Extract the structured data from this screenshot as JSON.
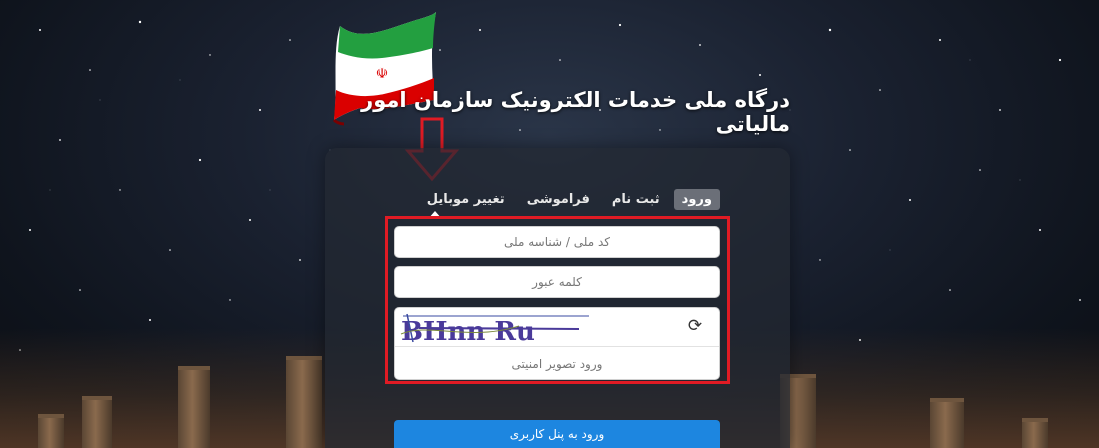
{
  "portal": {
    "title": "درگاه ملی خدمات الکترونیک سازمان امور مالیاتی"
  },
  "tabs": [
    {
      "label": "ورود",
      "active": true
    },
    {
      "label": "ثبت نام",
      "active": false
    },
    {
      "label": "فراموشی",
      "active": false
    },
    {
      "label": "تغییر موبایل",
      "active": false
    }
  ],
  "form": {
    "national_id_placeholder": "کد ملی / شناسه ملی",
    "password_placeholder": "کلمه عبور",
    "captcha_text": "BHnn Ru",
    "captcha_placeholder": "ورود تصویر امنیتی",
    "submit_label": "ورود به پنل کاربری"
  },
  "icons": {
    "refresh": "refresh-icon",
    "flag": "iran-flag-icon",
    "arrow": "down-arrow-icon"
  },
  "colors": {
    "highlight_border": "#e01b24",
    "submit_button": "#1d86e0",
    "active_tab": "#6b6f78"
  }
}
